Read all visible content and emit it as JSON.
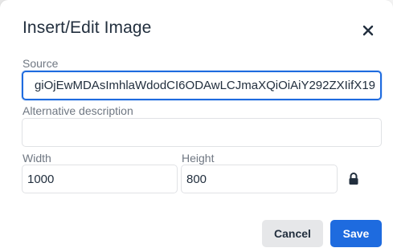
{
  "dialog": {
    "title": "Insert/Edit Image",
    "close_icon": "close-icon"
  },
  "source": {
    "label": "Source",
    "value": "giOjEwMDAsImhlaWdodCI6ODAwLCJmaXQiOiAiY292ZXIifX19"
  },
  "alt": {
    "label": "Alternative description",
    "value": ""
  },
  "width": {
    "label": "Width",
    "value": "1000"
  },
  "height": {
    "label": "Height",
    "value": "800"
  },
  "constrain_icon": "lock-icon",
  "buttons": {
    "cancel": "Cancel",
    "save": "Save"
  },
  "colors": {
    "primary": "#1e6bdf",
    "text": "#222f3e",
    "label": "#6f7782"
  }
}
